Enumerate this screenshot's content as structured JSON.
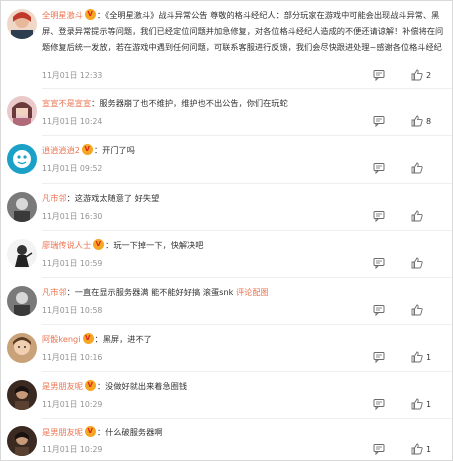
{
  "comments": [
    {
      "user": "全明星激斗",
      "badge": true,
      "colon": "：",
      "text": "《全明星激斗》战斗异常公告 尊敬的格斗经纪人：部分玩家在游戏中可能会出现战斗异常、黑屏、登录异常提示等问题，我们已经定位问题并加急修复，对各位格斗经纪人造成的不便还请谅解！补偿将在问题修复后统一发放，若在游戏中遇到任何问题，可联系客服进行反馈，我们会尽快跟进处理~感谢各位格斗经纪",
      "time": "11月01日 12:33",
      "likes": "2"
    },
    {
      "user": "宣宣不是宣宣",
      "badge": false,
      "colon": "：",
      "text": "服务器崩了也不维护，维护也不出公告，你们在玩蛇",
      "time": "11月01日 10:24",
      "likes": "8"
    },
    {
      "user": "逍逍逍逍2",
      "badge": true,
      "colon": "：",
      "text": "开门了吗",
      "time": "11月01日 09:52",
      "likes": ""
    },
    {
      "user": "凡市邻",
      "badge": false,
      "colon": "：",
      "text": "这游戏太随意了 好失望",
      "time": "11月01日 16:30",
      "likes": ""
    },
    {
      "user": "廖瑞传说人士",
      "badge": true,
      "colon": "：",
      "text": "玩一下掉一下，快解决吧",
      "time": "11月01日 10:59",
      "likes": ""
    },
    {
      "user": "凡市邻",
      "badge": false,
      "colon": "：",
      "text": "一直在显示服务器满 能不能好好搞 滚蛋snk",
      "link": "评论配图",
      "time": "11月01日 10:58",
      "likes": ""
    },
    {
      "user": "阿骰kengi",
      "badge": true,
      "colon": "：",
      "text": "黑屏，进不了",
      "time": "11月01日 10:16",
      "likes": "1"
    },
    {
      "user": "是男朋友呢",
      "badge": true,
      "colon": "：",
      "text": "没做好就出来着急圈钱",
      "time": "11月01日 10:29",
      "likes": "1"
    },
    {
      "user": "是男朋友呢",
      "badge": true,
      "colon": "：",
      "text": "什么破服务器啊",
      "time": "11月01日 10:29",
      "likes": "1"
    }
  ],
  "icons": {
    "reply": "comment-bubble-icon",
    "like": "thumbs-up-icon",
    "badge": "vip-badge-icon"
  },
  "colors": {
    "username": "#eb7350",
    "meta": "#939393",
    "text": "#333333"
  }
}
